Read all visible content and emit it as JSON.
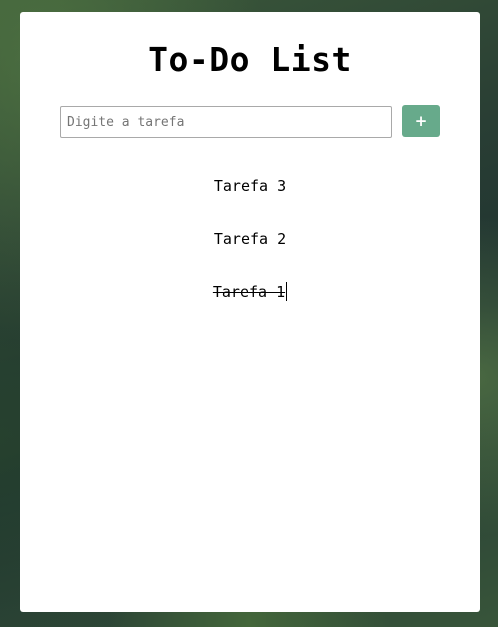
{
  "app": {
    "title": "To-Do List"
  },
  "input": {
    "placeholder": "Digite a tarefa",
    "value": ""
  },
  "add_button": {
    "label": "+",
    "color": "#67aa8b"
  },
  "tasks": [
    {
      "label": "Tarefa 3",
      "done": false
    },
    {
      "label": "Tarefa 2",
      "done": false
    },
    {
      "label": "Tarefa 1",
      "done": true
    }
  ]
}
